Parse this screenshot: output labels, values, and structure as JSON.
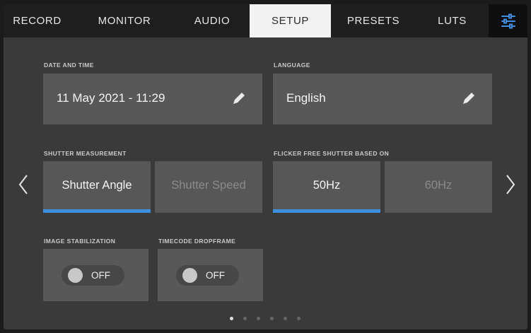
{
  "tabs": [
    {
      "label": "RECORD",
      "active": false
    },
    {
      "label": "MONITOR",
      "active": false
    },
    {
      "label": "AUDIO",
      "active": false
    },
    {
      "label": "SETUP",
      "active": true
    },
    {
      "label": "PRESETS",
      "active": false
    },
    {
      "label": "LUTS",
      "active": false
    }
  ],
  "settings_icon": "sliders-icon",
  "date_time": {
    "label": "DATE AND TIME",
    "value": "11 May 2021 - 11:29",
    "icon": "pencil-icon"
  },
  "language": {
    "label": "LANGUAGE",
    "value": "English",
    "icon": "pencil-icon"
  },
  "shutter_measurement": {
    "label": "SHUTTER MEASUREMENT",
    "options": [
      {
        "label": "Shutter Angle",
        "selected": true
      },
      {
        "label": "Shutter Speed",
        "selected": false
      }
    ]
  },
  "flicker_free": {
    "label": "FLICKER FREE SHUTTER BASED ON",
    "options": [
      {
        "label": "50Hz",
        "selected": true
      },
      {
        "label": "60Hz",
        "selected": false
      }
    ]
  },
  "image_stabilization": {
    "label": "IMAGE STABILIZATION",
    "state": "OFF"
  },
  "timecode_dropframe": {
    "label": "TIMECODE DROPFRAME",
    "state": "OFF"
  },
  "nav": {
    "prev_icon": "chevron-left-icon",
    "next_icon": "chevron-right-icon"
  },
  "pagination": {
    "current_page": 1,
    "total_pages": 6
  },
  "colors": {
    "accent": "#3f8fe0",
    "tab_active_bg": "#f2f2f2",
    "panel_bg": "#3a3a3a",
    "field_bg": "#585858"
  }
}
